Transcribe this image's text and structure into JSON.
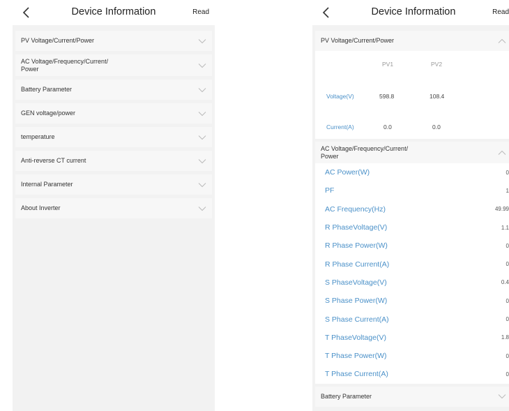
{
  "header": {
    "title": "Device Information",
    "read_label": "Read",
    "back_icon": "chevron-left-icon"
  },
  "left": {
    "sections": [
      {
        "title": "PV Voltage/Current/Power"
      },
      {
        "title": "AC Voltage/Frequency/Current/\nPower"
      },
      {
        "title": "Battery Parameter"
      },
      {
        "title": "GEN voltage/power"
      },
      {
        "title": "temperature"
      },
      {
        "title": "Anti-reverse CT current"
      },
      {
        "title": "Internal Parameter"
      },
      {
        "title": "About Inverter"
      }
    ]
  },
  "right": {
    "pv": {
      "title": "PV Voltage/Current/Power",
      "col1": "PV1",
      "col2": "PV2",
      "voltage_label": "Voltage(V)",
      "voltage_pv1": "598.8",
      "voltage_pv2": "108.4",
      "current_label": "Current(A)",
      "current_pv1": "0.0",
      "current_pv2": "0.0"
    },
    "ac": {
      "title": "AC Voltage/Frequency/Current/\nPower",
      "rows": [
        {
          "label": "AC Power(W)",
          "value": "0"
        },
        {
          "label": "PF",
          "value": "1"
        },
        {
          "label": "AC Frequency(Hz)",
          "value": "49.99"
        },
        {
          "label": "R PhaseVoltage(V)",
          "value": "1.1"
        },
        {
          "label": "R Phase Power(W)",
          "value": "0"
        },
        {
          "label": "R Phase Current(A)",
          "value": "0"
        },
        {
          "label": "S PhaseVoltage(V)",
          "value": "0.4"
        },
        {
          "label": "S Phase Power(W)",
          "value": "0"
        },
        {
          "label": "S Phase Current(A)",
          "value": "0"
        },
        {
          "label": "T PhaseVoltage(V)",
          "value": "1.8"
        },
        {
          "label": "T Phase Power(W)",
          "value": "0"
        },
        {
          "label": "T Phase Current(A)",
          "value": "0"
        }
      ]
    },
    "battery": {
      "title": "Battery Parameter"
    }
  },
  "colors": {
    "accent": "#4a90c8",
    "background": "#f2f2f2",
    "card": "#f7f7f7"
  }
}
